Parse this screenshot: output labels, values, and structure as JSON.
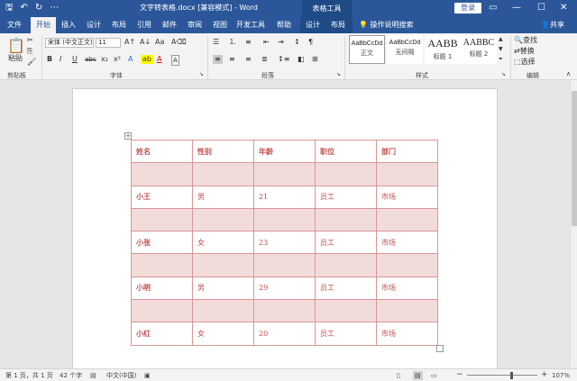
{
  "title_bar": {
    "doc_title": "文字转表格.docx [兼容模式] - Word",
    "context_group": "表格工具",
    "login": "登录"
  },
  "tabs": [
    "文件",
    "开始",
    "插入",
    "设计",
    "布局",
    "引用",
    "邮件",
    "审阅",
    "视图",
    "开发工具",
    "帮助"
  ],
  "context_tabs": [
    "设计",
    "布局"
  ],
  "tell_me": "操作说明搜索",
  "share": "共享",
  "ribbon": {
    "clipboard": {
      "paste": "粘贴",
      "label": "剪贴板"
    },
    "font": {
      "name": "宋体 (中文正文)",
      "size": "11",
      "label": "字体",
      "buttons": [
        "B",
        "I",
        "U",
        "abc",
        "x₂",
        "x²",
        "A",
        "A"
      ]
    },
    "paragraph": {
      "label": "段落"
    },
    "styles": {
      "label": "样式",
      "items": [
        {
          "sample": "AaBbCcDd",
          "name": "正文"
        },
        {
          "sample": "AaBbCcDd",
          "name": "无间隔"
        },
        {
          "sample": "AABB",
          "name": "标题 1"
        },
        {
          "sample": "AABBC",
          "name": "标题 2"
        }
      ]
    },
    "editing": {
      "label": "编辑",
      "find": "查找",
      "replace": "替换",
      "select": "选择"
    }
  },
  "table": {
    "headers": [
      "姓名",
      "性别",
      "年龄",
      "职位",
      "部门"
    ],
    "rows": [
      [
        "",
        "",
        "",
        "",
        ""
      ],
      [
        "小王",
        "男",
        "21",
        "员工",
        "市场"
      ],
      [
        "",
        "",
        "",
        "",
        ""
      ],
      [
        "小张",
        "女",
        "23",
        "员工",
        "市场"
      ],
      [
        "",
        "",
        "",
        "",
        ""
      ],
      [
        "小明",
        "男",
        "29",
        "员工",
        "市场"
      ],
      [
        "",
        "",
        "",
        "",
        ""
      ],
      [
        "小红",
        "女",
        "20",
        "员工",
        "市场"
      ]
    ]
  },
  "status": {
    "page": "第 1 页，共 1 页",
    "words": "42 个字",
    "language": "中文(中国)",
    "zoom": "107%"
  },
  "colors": {
    "accent": "#2b579a",
    "table_border": "#d99694",
    "table_text": "#c0504d",
    "table_shade": "#f2dcdb"
  }
}
